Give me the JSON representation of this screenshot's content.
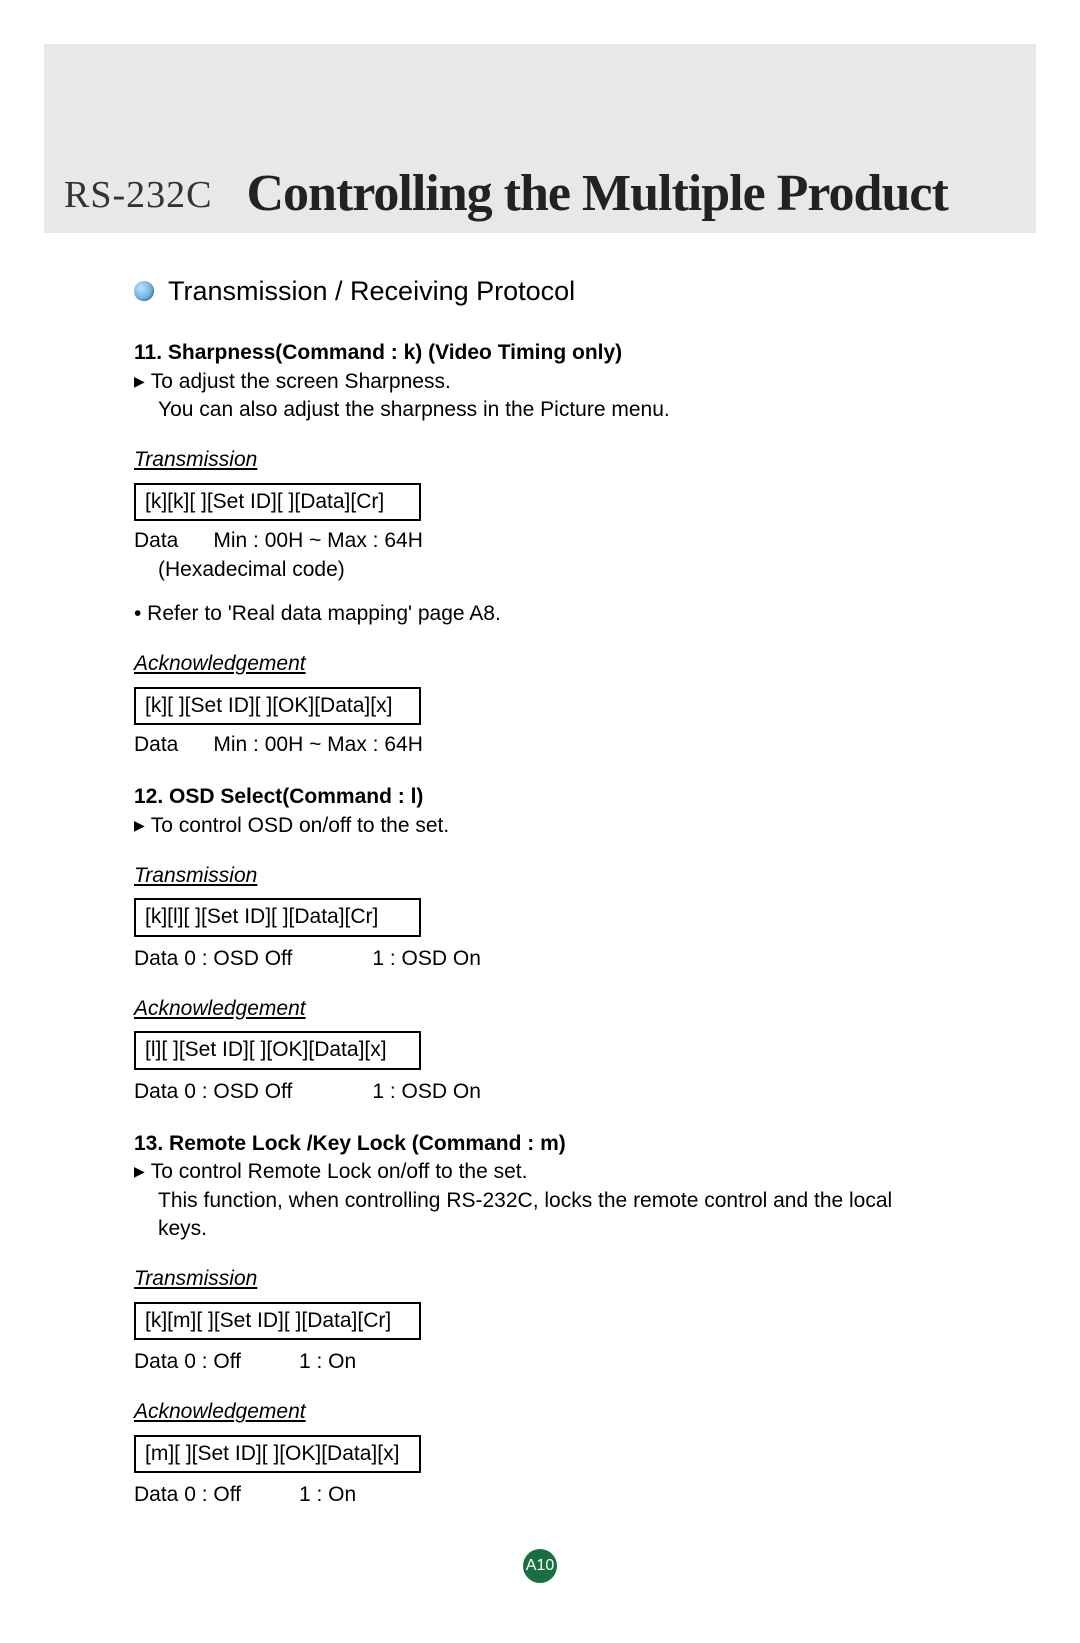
{
  "header": {
    "sub": "RS-232C",
    "main": "Controlling the Multiple Product"
  },
  "section_title": "Transmission / Receiving Protocol",
  "cmd11": {
    "title": "11. Sharpness(Command : k) (Video Timing only)",
    "desc1": "To adjust the screen Sharpness.",
    "desc2": "You can also adjust the sharpness in the Picture menu.",
    "trans_label": "Transmission",
    "trans_box": "[k][k][ ][Set ID][ ][Data][Cr]",
    "trans_data_label": "Data",
    "trans_data_val": "Min : 00H ~ Max : 64H",
    "trans_hex": "(Hexadecimal code)",
    "refer": "• Refer to 'Real data mapping' page A8.",
    "ack_label": "Acknowledgement",
    "ack_box": "[k][ ][Set ID][ ][OK][Data][x]",
    "ack_data_label": "Data",
    "ack_data_val": "Min : 00H ~ Max : 64H"
  },
  "cmd12": {
    "title": "12. OSD Select(Command : l)",
    "desc1": "To control OSD on/off to the set.",
    "trans_label": "Transmission",
    "trans_box": "[k][l][ ][Set ID][ ][Data][Cr]",
    "trans_data_a": "Data 0 : OSD Off",
    "trans_data_b": "1 : OSD On",
    "ack_label": "Acknowledgement",
    "ack_box": "[l][ ][Set ID][ ][OK][Data][x]",
    "ack_data_a": "Data 0 : OSD Off",
    "ack_data_b": "1 : OSD On"
  },
  "cmd13": {
    "title": "13. Remote Lock /Key Lock (Command : m)",
    "desc1": "To control Remote Lock on/off to the set.",
    "desc2": "This function, when controlling RS-232C, locks the remote control and the local keys.",
    "trans_label": "Transmission",
    "trans_box": "[k][m][ ][Set ID][ ][Data][Cr]",
    "trans_data_a": "Data 0 : Off",
    "trans_data_b": "1 : On",
    "ack_label": "Acknowledgement",
    "ack_box": "[m][ ][Set ID][ ][OK][Data][x]",
    "ack_data_a": "Data 0 : Off",
    "ack_data_b": "1 : On"
  },
  "page_number": "A10"
}
